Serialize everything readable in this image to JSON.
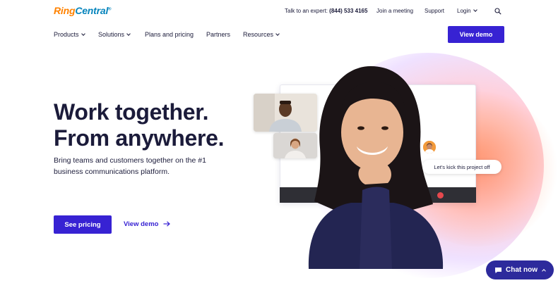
{
  "brand": {
    "ring": "RingCentral",
    "ring_part": "Ring",
    "central_part": "Central",
    "mark": "®"
  },
  "utility": {
    "expert_prefix": "Talk to an expert:",
    "expert_phone": "(844) 533 4165",
    "join": "Join a meeting",
    "support": "Support",
    "login": "Login"
  },
  "nav": {
    "products": "Products",
    "solutions": "Solutions",
    "plans": "Plans and pricing",
    "partners": "Partners",
    "resources": "Resources"
  },
  "header_cta": "View demo",
  "hero": {
    "headline_line1": "Work together.",
    "headline_line2": "From anywhere.",
    "subtext": "Bring teams and customers together on the #1 business communications platform.",
    "primary_cta": "See pricing",
    "secondary_cta": "View demo"
  },
  "video": {
    "chat_message": "Let's kick this project off"
  },
  "chat_widget": {
    "label": "Chat now"
  },
  "icons": {
    "search": "search-icon",
    "arrow": "arrow-right-icon",
    "chat": "chat-bubble-icon"
  },
  "colors": {
    "primary": "#3722d3",
    "chat": "#2d2a9c",
    "logo_orange": "#ff8200",
    "logo_blue": "#0684bc",
    "text": "#1b1b3a"
  }
}
